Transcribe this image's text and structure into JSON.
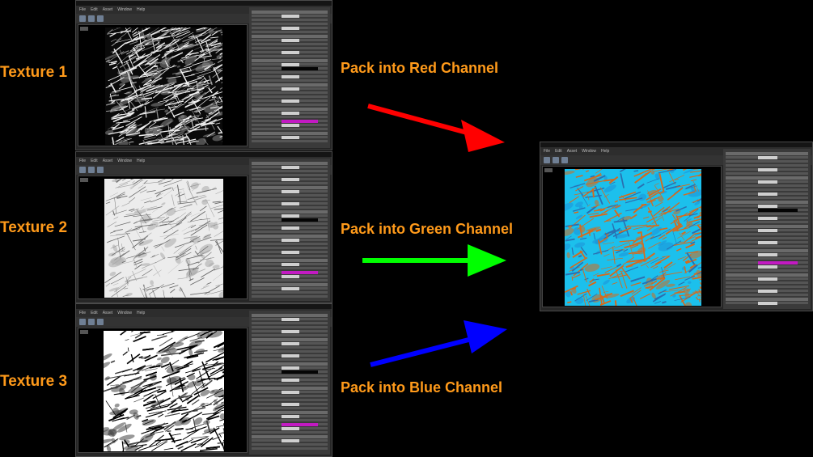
{
  "textures": [
    {
      "label": "Texture 1"
    },
    {
      "label": "Texture 2"
    },
    {
      "label": "Texture 3"
    }
  ],
  "channels": [
    {
      "label": "Pack into Red Channel",
      "arrow_color": "#ff0000"
    },
    {
      "label": "Pack into Green Channel",
      "arrow_color": "#00ff00"
    },
    {
      "label": "Pack into Blue Channel",
      "arrow_color": "#0000ff"
    }
  ],
  "editor": {
    "menu": [
      "File",
      "Edit",
      "Asset",
      "Window",
      "Help"
    ],
    "tool_icons": [
      "save-icon",
      "find-in-browser-icon",
      "reimport-icon"
    ]
  },
  "colors": {
    "label": "#ff9a1a",
    "result_base": "#1cc0ec",
    "result_streak": "#d66a1c",
    "panel_accent": "#c21ac2"
  }
}
